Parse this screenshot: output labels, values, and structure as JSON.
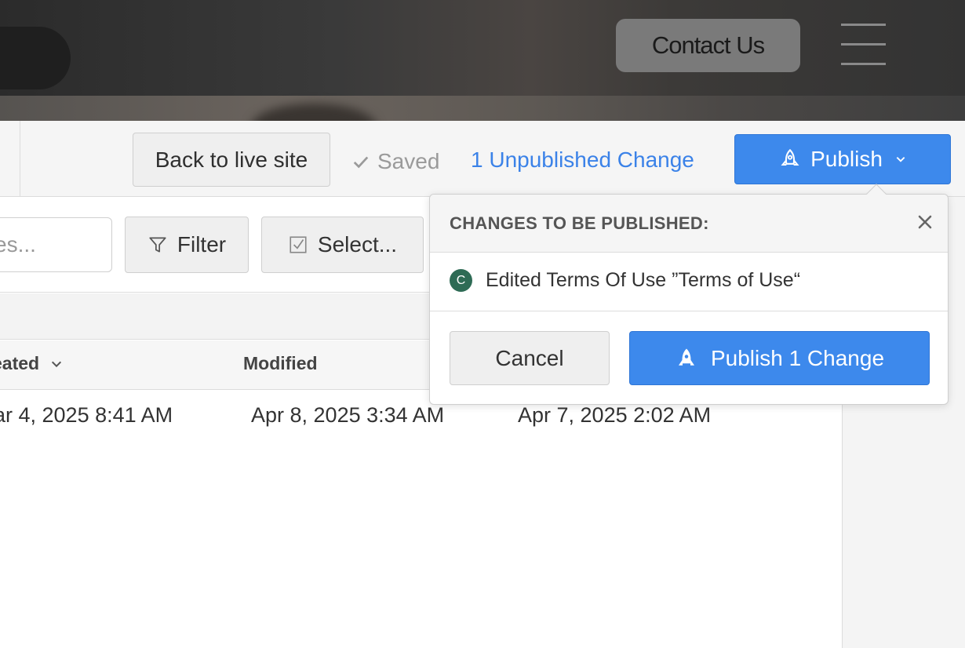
{
  "header": {
    "contact_label": "Contact Us",
    "menu_icon": "hamburger-menu-icon"
  },
  "toolbar": {
    "back_label": "Back to live site",
    "saved_label": "Saved",
    "unpublished_label": "1 Unpublished Change",
    "publish_label": "Publish",
    "accent_color": "#3d89ec"
  },
  "filters": {
    "search_placeholder": "es...",
    "filter_label": "Filter",
    "select_label": "Select..."
  },
  "table": {
    "columns": [
      "eated",
      "Modified"
    ],
    "rows": [
      [
        "lar 4, 2025 8:41 AM",
        "Apr 8, 2025 3:34 AM",
        "Apr 7, 2025 2:02 AM"
      ]
    ]
  },
  "popover": {
    "title": "CHANGES TO BE PUBLISHED:",
    "item_avatar": "C",
    "item_text": "Edited Terms Of Use ”Terms of Use“",
    "cancel_label": "Cancel",
    "publish_label": "Publish 1 Change"
  }
}
